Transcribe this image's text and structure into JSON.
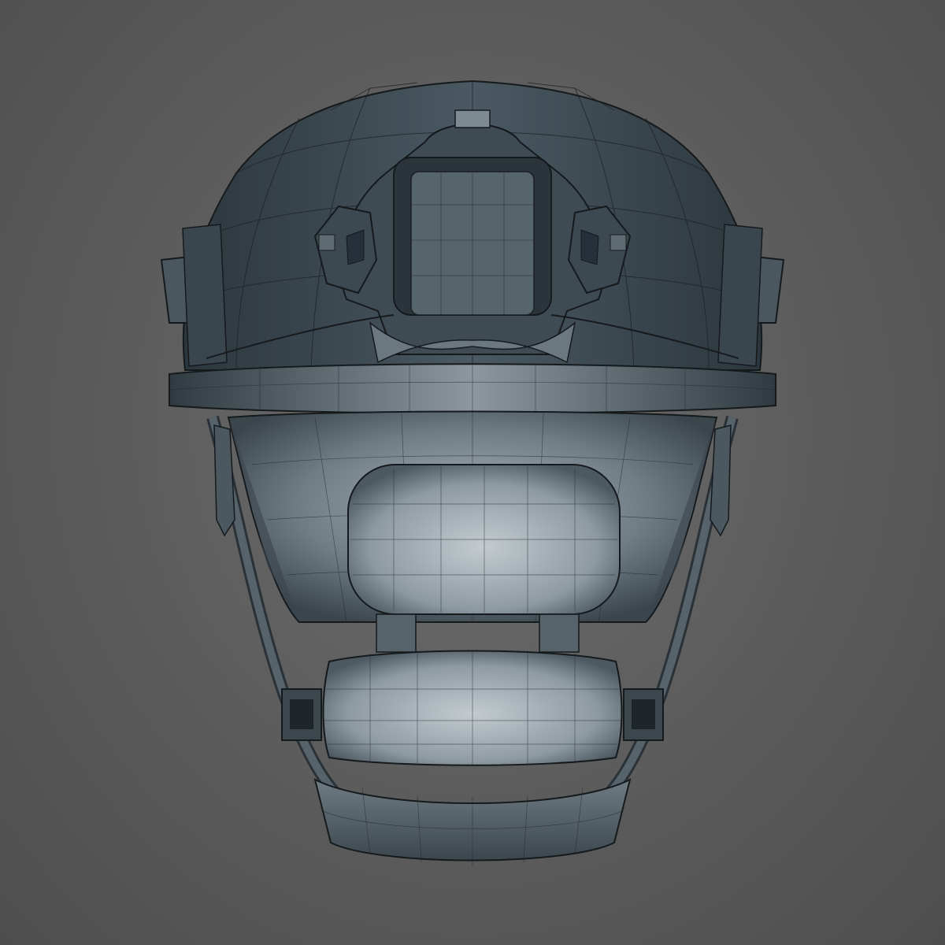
{
  "scene": {
    "object": "helmet-wireframe-model",
    "palette": {
      "background": "#5e5e5e",
      "shell_dark": "#2f3a42",
      "shell_mid": "#48565f",
      "shell_light": "#9aa6ad",
      "pad_light": "#b5bec4",
      "wire": "#1d2226"
    }
  }
}
